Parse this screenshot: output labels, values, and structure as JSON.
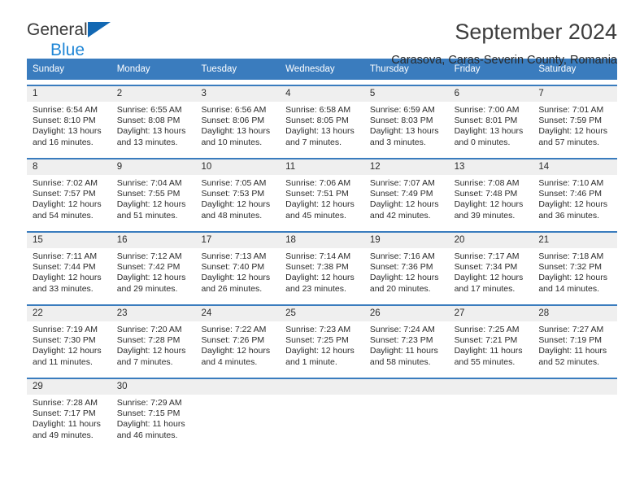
{
  "brand": {
    "name_part1": "General",
    "name_part2": "Blue",
    "triangle_color": "#1268b3",
    "blue_color": "#1f86d6"
  },
  "header": {
    "title": "September 2024",
    "subtitle": "Carasova, Caras-Severin County, Romania"
  },
  "theme": {
    "header_blue": "#3a7cbe",
    "day_band_gray": "#efefef",
    "text_color": "#2b2b2b"
  },
  "weekdays": [
    "Sunday",
    "Monday",
    "Tuesday",
    "Wednesday",
    "Thursday",
    "Friday",
    "Saturday"
  ],
  "weeks": [
    [
      {
        "day": "1",
        "sunrise": "Sunrise: 6:54 AM",
        "sunset": "Sunset: 8:10 PM",
        "daylight1": "Daylight: 13 hours",
        "daylight2": "and 16 minutes."
      },
      {
        "day": "2",
        "sunrise": "Sunrise: 6:55 AM",
        "sunset": "Sunset: 8:08 PM",
        "daylight1": "Daylight: 13 hours",
        "daylight2": "and 13 minutes."
      },
      {
        "day": "3",
        "sunrise": "Sunrise: 6:56 AM",
        "sunset": "Sunset: 8:06 PM",
        "daylight1": "Daylight: 13 hours",
        "daylight2": "and 10 minutes."
      },
      {
        "day": "4",
        "sunrise": "Sunrise: 6:58 AM",
        "sunset": "Sunset: 8:05 PM",
        "daylight1": "Daylight: 13 hours",
        "daylight2": "and 7 minutes."
      },
      {
        "day": "5",
        "sunrise": "Sunrise: 6:59 AM",
        "sunset": "Sunset: 8:03 PM",
        "daylight1": "Daylight: 13 hours",
        "daylight2": "and 3 minutes."
      },
      {
        "day": "6",
        "sunrise": "Sunrise: 7:00 AM",
        "sunset": "Sunset: 8:01 PM",
        "daylight1": "Daylight: 13 hours",
        "daylight2": "and 0 minutes."
      },
      {
        "day": "7",
        "sunrise": "Sunrise: 7:01 AM",
        "sunset": "Sunset: 7:59 PM",
        "daylight1": "Daylight: 12 hours",
        "daylight2": "and 57 minutes."
      }
    ],
    [
      {
        "day": "8",
        "sunrise": "Sunrise: 7:02 AM",
        "sunset": "Sunset: 7:57 PM",
        "daylight1": "Daylight: 12 hours",
        "daylight2": "and 54 minutes."
      },
      {
        "day": "9",
        "sunrise": "Sunrise: 7:04 AM",
        "sunset": "Sunset: 7:55 PM",
        "daylight1": "Daylight: 12 hours",
        "daylight2": "and 51 minutes."
      },
      {
        "day": "10",
        "sunrise": "Sunrise: 7:05 AM",
        "sunset": "Sunset: 7:53 PM",
        "daylight1": "Daylight: 12 hours",
        "daylight2": "and 48 minutes."
      },
      {
        "day": "11",
        "sunrise": "Sunrise: 7:06 AM",
        "sunset": "Sunset: 7:51 PM",
        "daylight1": "Daylight: 12 hours",
        "daylight2": "and 45 minutes."
      },
      {
        "day": "12",
        "sunrise": "Sunrise: 7:07 AM",
        "sunset": "Sunset: 7:49 PM",
        "daylight1": "Daylight: 12 hours",
        "daylight2": "and 42 minutes."
      },
      {
        "day": "13",
        "sunrise": "Sunrise: 7:08 AM",
        "sunset": "Sunset: 7:48 PM",
        "daylight1": "Daylight: 12 hours",
        "daylight2": "and 39 minutes."
      },
      {
        "day": "14",
        "sunrise": "Sunrise: 7:10 AM",
        "sunset": "Sunset: 7:46 PM",
        "daylight1": "Daylight: 12 hours",
        "daylight2": "and 36 minutes."
      }
    ],
    [
      {
        "day": "15",
        "sunrise": "Sunrise: 7:11 AM",
        "sunset": "Sunset: 7:44 PM",
        "daylight1": "Daylight: 12 hours",
        "daylight2": "and 33 minutes."
      },
      {
        "day": "16",
        "sunrise": "Sunrise: 7:12 AM",
        "sunset": "Sunset: 7:42 PM",
        "daylight1": "Daylight: 12 hours",
        "daylight2": "and 29 minutes."
      },
      {
        "day": "17",
        "sunrise": "Sunrise: 7:13 AM",
        "sunset": "Sunset: 7:40 PM",
        "daylight1": "Daylight: 12 hours",
        "daylight2": "and 26 minutes."
      },
      {
        "day": "18",
        "sunrise": "Sunrise: 7:14 AM",
        "sunset": "Sunset: 7:38 PM",
        "daylight1": "Daylight: 12 hours",
        "daylight2": "and 23 minutes."
      },
      {
        "day": "19",
        "sunrise": "Sunrise: 7:16 AM",
        "sunset": "Sunset: 7:36 PM",
        "daylight1": "Daylight: 12 hours",
        "daylight2": "and 20 minutes."
      },
      {
        "day": "20",
        "sunrise": "Sunrise: 7:17 AM",
        "sunset": "Sunset: 7:34 PM",
        "daylight1": "Daylight: 12 hours",
        "daylight2": "and 17 minutes."
      },
      {
        "day": "21",
        "sunrise": "Sunrise: 7:18 AM",
        "sunset": "Sunset: 7:32 PM",
        "daylight1": "Daylight: 12 hours",
        "daylight2": "and 14 minutes."
      }
    ],
    [
      {
        "day": "22",
        "sunrise": "Sunrise: 7:19 AM",
        "sunset": "Sunset: 7:30 PM",
        "daylight1": "Daylight: 12 hours",
        "daylight2": "and 11 minutes."
      },
      {
        "day": "23",
        "sunrise": "Sunrise: 7:20 AM",
        "sunset": "Sunset: 7:28 PM",
        "daylight1": "Daylight: 12 hours",
        "daylight2": "and 7 minutes."
      },
      {
        "day": "24",
        "sunrise": "Sunrise: 7:22 AM",
        "sunset": "Sunset: 7:26 PM",
        "daylight1": "Daylight: 12 hours",
        "daylight2": "and 4 minutes."
      },
      {
        "day": "25",
        "sunrise": "Sunrise: 7:23 AM",
        "sunset": "Sunset: 7:25 PM",
        "daylight1": "Daylight: 12 hours",
        "daylight2": "and 1 minute."
      },
      {
        "day": "26",
        "sunrise": "Sunrise: 7:24 AM",
        "sunset": "Sunset: 7:23 PM",
        "daylight1": "Daylight: 11 hours",
        "daylight2": "and 58 minutes."
      },
      {
        "day": "27",
        "sunrise": "Sunrise: 7:25 AM",
        "sunset": "Sunset: 7:21 PM",
        "daylight1": "Daylight: 11 hours",
        "daylight2": "and 55 minutes."
      },
      {
        "day": "28",
        "sunrise": "Sunrise: 7:27 AM",
        "sunset": "Sunset: 7:19 PM",
        "daylight1": "Daylight: 11 hours",
        "daylight2": "and 52 minutes."
      }
    ],
    [
      {
        "day": "29",
        "sunrise": "Sunrise: 7:28 AM",
        "sunset": "Sunset: 7:17 PM",
        "daylight1": "Daylight: 11 hours",
        "daylight2": "and 49 minutes."
      },
      {
        "day": "30",
        "sunrise": "Sunrise: 7:29 AM",
        "sunset": "Sunset: 7:15 PM",
        "daylight1": "Daylight: 11 hours",
        "daylight2": "and 46 minutes."
      },
      {
        "day": "",
        "sunrise": "",
        "sunset": "",
        "daylight1": "",
        "daylight2": ""
      },
      {
        "day": "",
        "sunrise": "",
        "sunset": "",
        "daylight1": "",
        "daylight2": ""
      },
      {
        "day": "",
        "sunrise": "",
        "sunset": "",
        "daylight1": "",
        "daylight2": ""
      },
      {
        "day": "",
        "sunrise": "",
        "sunset": "",
        "daylight1": "",
        "daylight2": ""
      },
      {
        "day": "",
        "sunrise": "",
        "sunset": "",
        "daylight1": "",
        "daylight2": ""
      }
    ]
  ]
}
